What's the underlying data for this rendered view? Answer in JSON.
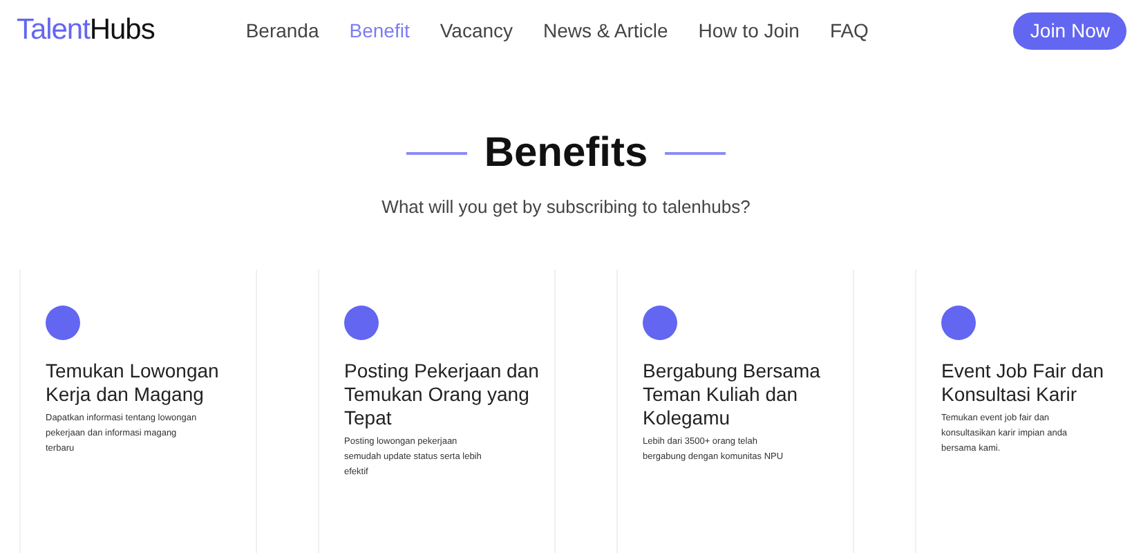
{
  "logo": {
    "first": "Talent",
    "second": "Hubs"
  },
  "nav": [
    {
      "label": "Beranda",
      "selected": false
    },
    {
      "label": "Benefit",
      "selected": true
    },
    {
      "label": "Vacancy",
      "selected": false
    },
    {
      "label": "News & Article",
      "selected": false
    },
    {
      "label": "How to Join",
      "selected": false
    },
    {
      "label": "FAQ",
      "selected": false
    }
  ],
  "cta": "Join Now",
  "section": {
    "title": "Benefits",
    "subtitle": "What will you get by subscribing to talenhubs?"
  },
  "cards": [
    {
      "title": "Temukan Lowongan Kerja dan Magang",
      "description": "Dapatkan informasi tentang lowongan pekerjaan dan informasi magang terbaru"
    },
    {
      "title": "Posting Pekerjaan dan Temukan Orang yang Tepat",
      "description": "Posting lowongan pekerjaan semudah update status serta lebih efektif"
    },
    {
      "title": "Bergabung Bersama Teman Kuliah dan Kolegamu",
      "description": "Lebih dari 3500+ orang telah bergabung dengan komunitas NPU"
    },
    {
      "title": "Event Job Fair dan Konsultasi Karir",
      "description": "Temukan event job fair dan konsultasikan karir impian anda bersama kami."
    }
  ]
}
